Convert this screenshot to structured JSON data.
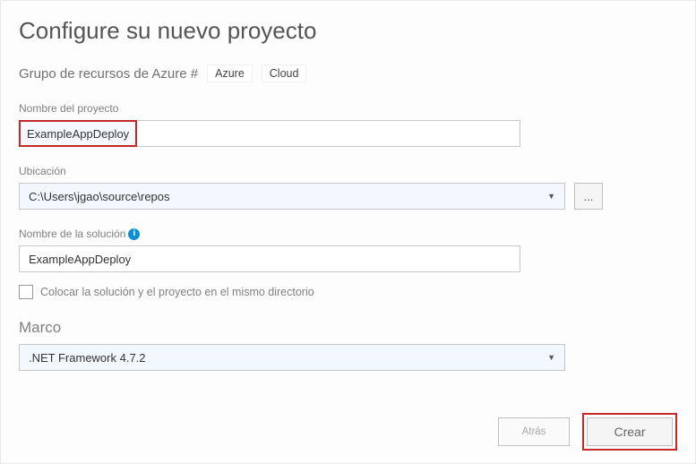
{
  "title": "Configure su nuevo proyecto",
  "tags": {
    "label": "Grupo de recursos de Azure #",
    "items": [
      "Azure",
      "Cloud"
    ]
  },
  "projectName": {
    "label": "Nombre del proyecto",
    "value": "ExampleAppDeploy"
  },
  "location": {
    "label": "Ubicación",
    "value": "C:\\Users\\jgao\\source\\repos",
    "browse": "..."
  },
  "solutionName": {
    "label": "Nombre de la solución",
    "value": "ExampleAppDeploy"
  },
  "sameDir": {
    "label": "Colocar la solución y el proyecto en el mismo directorio"
  },
  "framework": {
    "heading": "Marco",
    "value": ".NET Framework 4.7.2"
  },
  "buttons": {
    "back": "Atrás",
    "create": "Crear"
  }
}
